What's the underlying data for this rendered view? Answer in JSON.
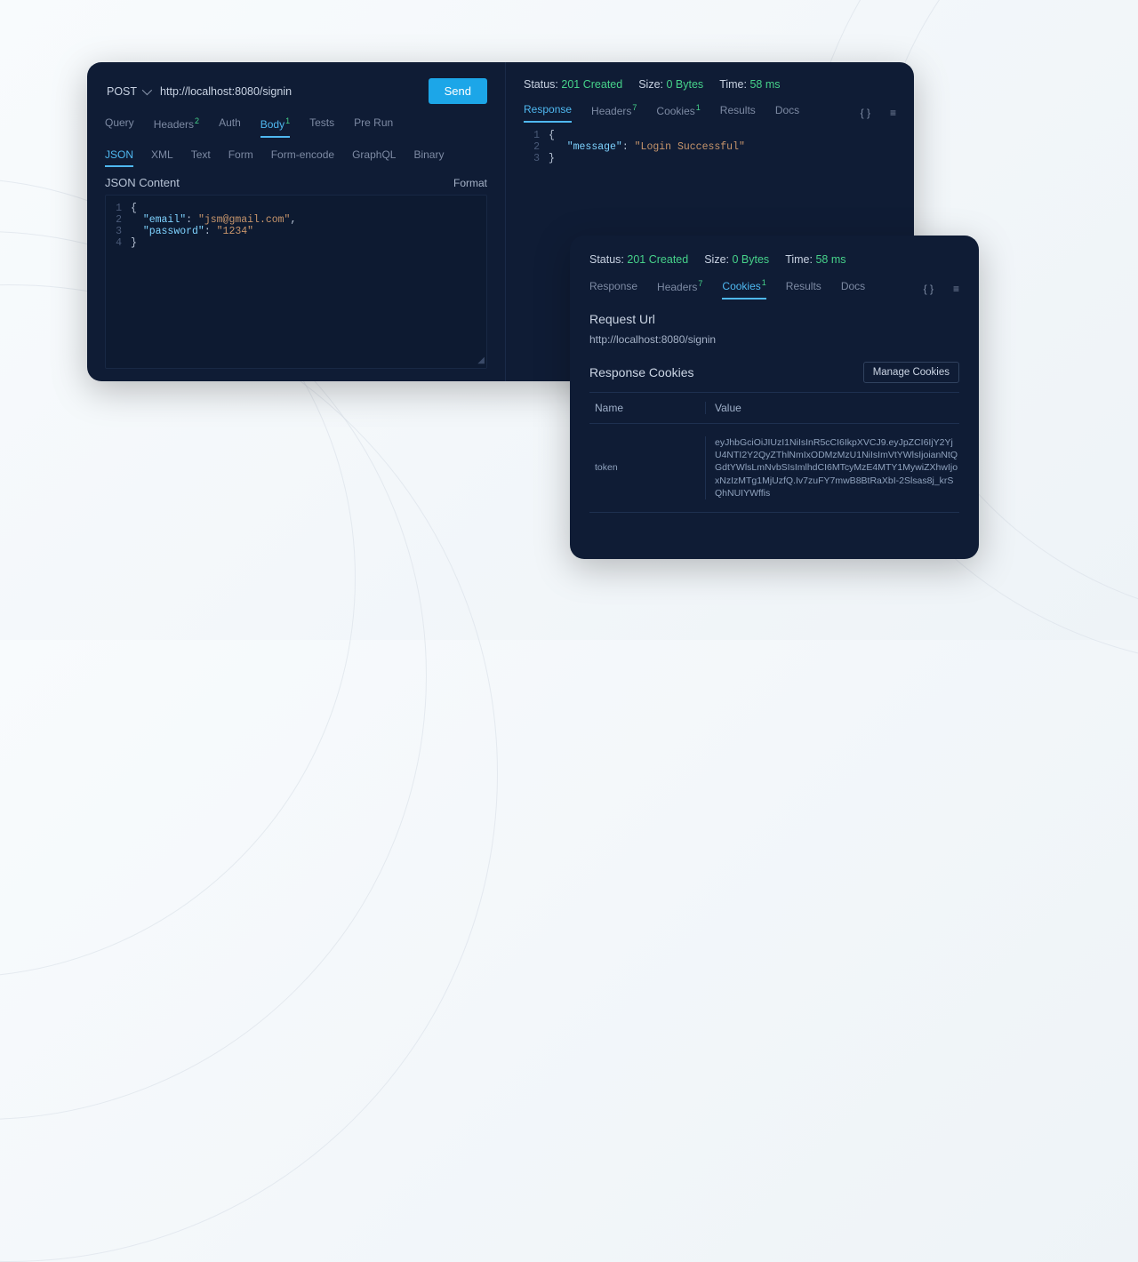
{
  "request": {
    "method": "POST",
    "url": "http://localhost:8080/signin",
    "send_label": "Send",
    "tabs": {
      "query": "Query",
      "headers": "Headers",
      "headers_count": "2",
      "auth": "Auth",
      "body": "Body",
      "body_count": "1",
      "tests": "Tests",
      "prerun": "Pre Run"
    },
    "body_types": {
      "json": "JSON",
      "xml": "XML",
      "text": "Text",
      "form": "Form",
      "formencode": "Form-encode",
      "graphql": "GraphQL",
      "binary": "Binary"
    },
    "content_label": "JSON Content",
    "format_label": "Format",
    "json_lines": [
      "{",
      "  \"email\": \"jsm@gmail.com\",",
      "  \"password\": \"1234\"",
      "}"
    ]
  },
  "response1": {
    "status_label": "Status:",
    "status_value": "201 Created",
    "size_label": "Size:",
    "size_value": "0 Bytes",
    "time_label": "Time:",
    "time_value": "58 ms",
    "tabs": {
      "response": "Response",
      "headers": "Headers",
      "headers_count": "7",
      "cookies": "Cookies",
      "cookies_count": "1",
      "results": "Results",
      "docs": "Docs"
    },
    "body_lines": [
      "{",
      "   \"message\": \"Login Successful\"",
      "}"
    ]
  },
  "response2": {
    "status_label": "Status:",
    "status_value": "201 Created",
    "size_label": "Size:",
    "size_value": "0 Bytes",
    "time_label": "Time:",
    "time_value": "58 ms",
    "tabs": {
      "response": "Response",
      "headers": "Headers",
      "headers_count": "7",
      "cookies": "Cookies",
      "cookies_count": "1",
      "results": "Results",
      "docs": "Docs"
    },
    "request_url_label": "Request Url",
    "request_url": "http://localhost:8080/signin",
    "response_cookies_label": "Response Cookies",
    "manage_label": "Manage Cookies",
    "table": {
      "name_header": "Name",
      "value_header": "Value",
      "name": "token",
      "value": "eyJhbGciOiJIUzI1NiIsInR5cCI6IkpXVCJ9.eyJpZCI6IjY2YjU4NTI2Y2QyZThlNmIxODMzMzU1NiIsImVtYWlsIjoianNtQGdtYWlsLmNvbSIsImlhdCI6MTcyMzE4MTY1MywiZXhwIjoxNzIzMTg1MjUzfQ.Iv7zuFY7mwB8BtRaXbI-2Slsas8j_krSQhNUIYWffis"
    }
  }
}
